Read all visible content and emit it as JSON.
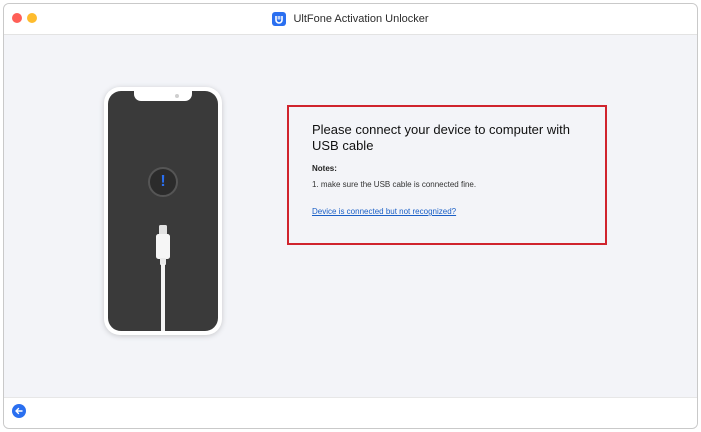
{
  "window": {
    "title": "UltFone Activation Unlocker",
    "controls": [
      "close",
      "minimize"
    ]
  },
  "main": {
    "heading": "Please connect your device to computer with USB cable",
    "notes_title": "Notes:",
    "notes": [
      "1. make sure the USB cable is connected fine."
    ],
    "help_link": "Device is connected but not recognized?"
  },
  "icons": {
    "app_logo": "ultfone-logo-icon",
    "alert": "exclamation-icon",
    "back": "back-arrow-icon"
  },
  "colors": {
    "accent": "#2a6ff0",
    "highlight_border": "#d0242d",
    "link": "#1a5fc6"
  }
}
